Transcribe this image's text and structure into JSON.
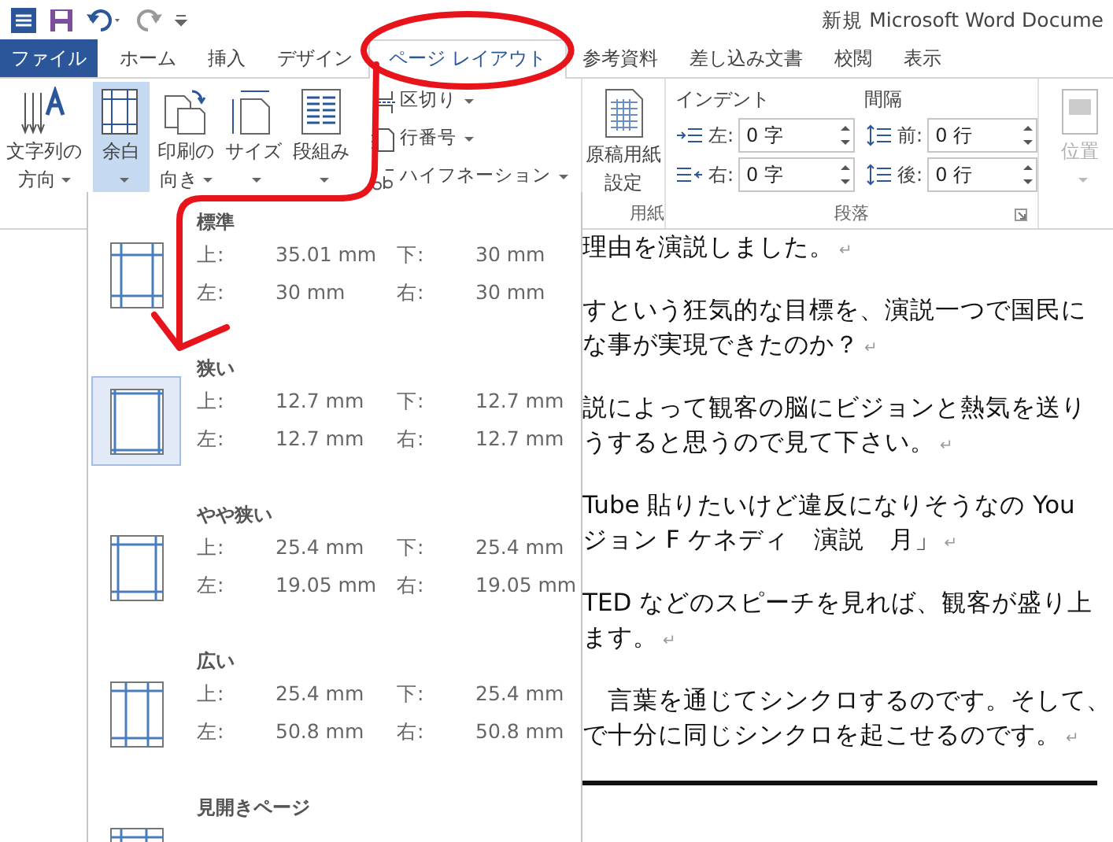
{
  "title_bar": {
    "title": "新規 Microsoft Word Docume"
  },
  "tabs": [
    {
      "label": "ファイル",
      "kind": "file",
      "selected": false
    },
    {
      "label": "ホーム",
      "kind": "tab",
      "selected": false
    },
    {
      "label": "挿入",
      "kind": "tab",
      "selected": false
    },
    {
      "label": "デザイン",
      "kind": "tab",
      "selected": false
    },
    {
      "label": "ページ レイアウト",
      "kind": "tab",
      "selected": true
    },
    {
      "label": "参考資料",
      "kind": "tab",
      "selected": false
    },
    {
      "label": "差し込み文書",
      "kind": "tab",
      "selected": false
    },
    {
      "label": "校閲",
      "kind": "tab",
      "selected": false
    },
    {
      "label": "表示",
      "kind": "tab",
      "selected": false
    }
  ],
  "page_setup_buttons": [
    {
      "kind": "text-direction",
      "lines": [
        "文字列の",
        "方向"
      ],
      "dropdown": true,
      "selected": false
    },
    {
      "kind": "margins",
      "lines": [
        "余白"
      ],
      "dropdown": true,
      "selected": true
    },
    {
      "kind": "orientation",
      "lines": [
        "印刷の",
        "向き"
      ],
      "dropdown": true,
      "selected": false
    },
    {
      "kind": "size",
      "lines": [
        "サイズ"
      ],
      "dropdown": true,
      "selected": false
    },
    {
      "kind": "columns",
      "lines": [
        "段組み"
      ],
      "dropdown": true,
      "selected": false
    }
  ],
  "small_commands": [
    {
      "kind": "breaks",
      "label": "区切り",
      "dropdown": true
    },
    {
      "kind": "line-numbers",
      "label": "行番号",
      "dropdown": true
    },
    {
      "kind": "hyphenation",
      "label": "ハイフネーション",
      "dropdown": true
    }
  ],
  "manuscript_button": {
    "lines": [
      "原稿用紙",
      "設定"
    ]
  },
  "paragraph_fields": [
    {
      "heading": "インデント",
      "fields": [
        {
          "kind": "indent-left",
          "label": "左:",
          "value": "0 字"
        },
        {
          "kind": "indent-right",
          "label": "右:",
          "value": "0 字"
        }
      ]
    },
    {
      "heading": "間隔",
      "fields": [
        {
          "kind": "space-before",
          "label": "前:",
          "value": "0 行"
        },
        {
          "kind": "space-after",
          "label": "後:",
          "value": "0 行"
        }
      ]
    }
  ],
  "position_button": {
    "label": "位置",
    "disabled": true,
    "dropdown": true
  },
  "group_labels": [
    {
      "label": "用紙",
      "launcher": false
    },
    {
      "label": "段落",
      "launcher": true
    }
  ],
  "margins_menu": {
    "items": [
      {
        "name": "標準",
        "kind": "normal",
        "selected": false,
        "rows": [
          [
            "上:",
            "35.01 mm",
            "下:",
            "30 mm"
          ],
          [
            "左:",
            "30 mm",
            "右:",
            "30 mm"
          ]
        ]
      },
      {
        "name": "狭い",
        "kind": "narrow",
        "selected": true,
        "rows": [
          [
            "上:",
            "12.7 mm",
            "下:",
            "12.7 mm"
          ],
          [
            "左:",
            "12.7 mm",
            "右:",
            "12.7 mm"
          ]
        ]
      },
      {
        "name": "やや狭い",
        "kind": "moderate",
        "selected": false,
        "rows": [
          [
            "上:",
            "25.4 mm",
            "下:",
            "25.4 mm"
          ],
          [
            "左:",
            "19.05 mm",
            "右:",
            "19.05 mm"
          ]
        ]
      },
      {
        "name": "広い",
        "kind": "wide",
        "selected": false,
        "rows": [
          [
            "上:",
            "25.4 mm",
            "下:",
            "25.4 mm"
          ],
          [
            "左:",
            "50.8 mm",
            "右:",
            "50.8 mm"
          ]
        ]
      },
      {
        "name": "見開きページ",
        "kind": "mirrored",
        "selected": false
      }
    ]
  },
  "document": {
    "paragraphs": [
      {
        "lines": [
          "理由を演説しました。"
        ],
        "mark": "↵"
      },
      {
        "lines": [
          "すという狂気的な目標を、演説一つで国民に",
          "な事が実現できたのか？"
        ],
        "mark": "↵"
      },
      {
        "lines": [
          "説によって観客の脳にビジョンと熱気を送り",
          "うすると思うので見て下さい。"
        ],
        "mark": "↵"
      },
      {
        "lines": [
          "Tube 貼りたいけど違反になりそうなの You",
          "ジョン F ケネディ　演説　月」"
        ],
        "mark": "↵"
      },
      {
        "lines": [
          "TED などのスピーチを見れば、観客が盛り上",
          "ます。"
        ],
        "mark": "↵"
      },
      {
        "lines": [
          "　言葉を通じてシンクロするのです。そして、",
          "で十分に同じシンクロを起こせるのです。"
        ],
        "mark": "↵"
      }
    ]
  }
}
